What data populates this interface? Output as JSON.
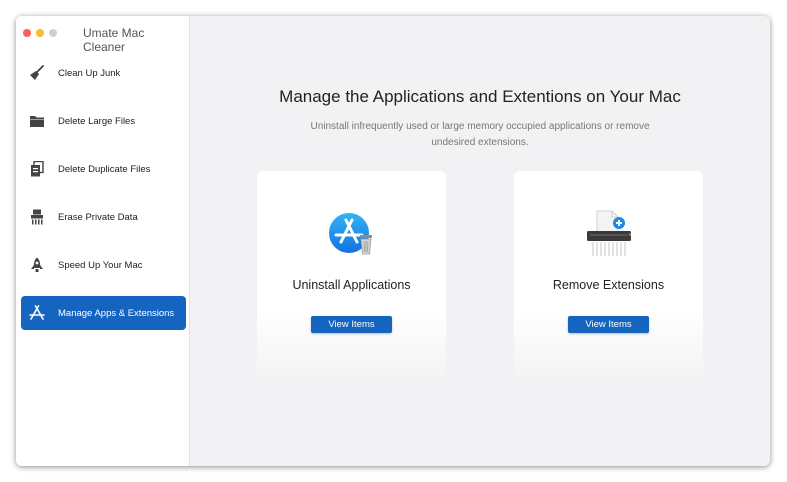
{
  "window": {
    "title": "Umate Mac Cleaner"
  },
  "sidebar": {
    "items": [
      {
        "label": "Clean Up Junk",
        "icon": "broom-icon",
        "active": false
      },
      {
        "label": "Delete Large Files",
        "icon": "folder-icon",
        "active": false
      },
      {
        "label": "Delete Duplicate Files",
        "icon": "duplicate-files-icon",
        "active": false
      },
      {
        "label": "Erase Private Data",
        "icon": "shredder-icon",
        "active": false
      },
      {
        "label": "Speed Up Your Mac",
        "icon": "rocket-icon",
        "active": false
      },
      {
        "label": "Manage Apps & Extensions",
        "icon": "app-store-icon",
        "active": true
      }
    ]
  },
  "main": {
    "heading": "Manage the Applications and Extentions on Your Mac",
    "subtext": "Uninstall infrequently used or large memory occupied applications or remove undesired extensions.",
    "cards": [
      {
        "title": "Uninstall Applications",
        "button": "View Items",
        "icon": "app-store-trash-icon"
      },
      {
        "title": "Remove Extensions",
        "button": "View Items",
        "icon": "extension-shredder-icon"
      }
    ]
  },
  "colors": {
    "accent": "#1565c0",
    "sidebar_bg": "#ffffff",
    "main_bg": "#f2f2f4",
    "close": "#fc5f57",
    "minimize": "#fdbc2e",
    "zoom": "#d0d0d2"
  }
}
